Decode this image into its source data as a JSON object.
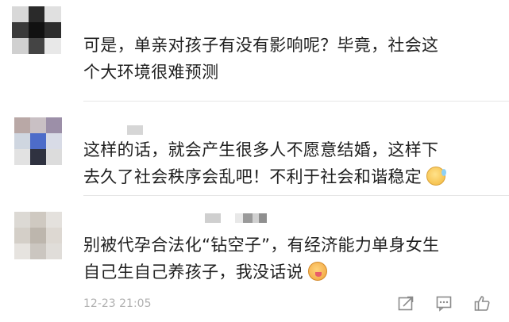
{
  "comments": [
    {
      "text": "可是，单亲对孩子有没有影响呢？毕竟，社会这\n个大环境很难预测"
    },
    {
      "text": "这样的话，就会产生很多人不愿意结婚，这样下\n去久了社会秩序会乱吧！不利于社会和谐稳定",
      "emoji": "cold-sweat-emoji"
    },
    {
      "text": "别被代孕合法化“钻空子”，有经济能力单身女生\n自己生自己养孩子，我没话说",
      "emoji": "drooling-emoji",
      "timestamp": "12-23 21:05"
    }
  ],
  "icons": {
    "share": "share-icon",
    "comment": "comment-icon",
    "like": "thumbs-up-icon"
  }
}
